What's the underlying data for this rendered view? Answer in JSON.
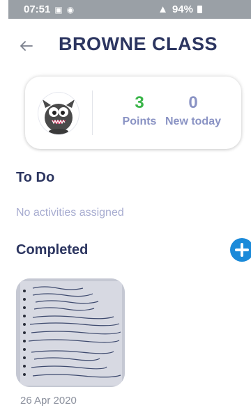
{
  "status_bar": {
    "time": "07:51",
    "battery": "94%"
  },
  "header": {
    "title": "BROWNE CLASS"
  },
  "stats": {
    "points_value": "3",
    "points_label": "Points",
    "new_value": "0",
    "new_label": "New today"
  },
  "todo": {
    "title": "To Do",
    "empty_text": "No activities assigned"
  },
  "completed": {
    "title": "Completed",
    "items": [
      {
        "date": "26 Apr 2020"
      }
    ]
  },
  "colors": {
    "title": "#2c3560",
    "points": "#3ab549",
    "muted": "#8a93c4",
    "accent": "#1b8ad9"
  }
}
